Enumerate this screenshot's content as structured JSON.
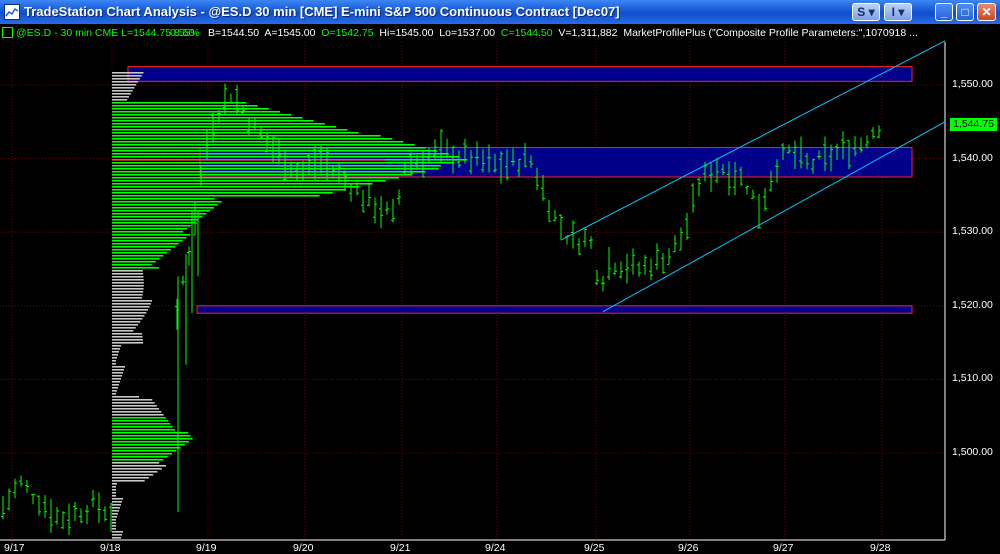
{
  "window": {
    "title": "TradeStation Chart Analysis - @ES.D  30 min  [CME] E-mini S&P 500 Continuous Contract [Dec07]",
    "buttons": {
      "s_menu": "S",
      "i_menu": "I"
    }
  },
  "infobar": {
    "symbol": "@ES.D - 30 min  CME",
    "last": "L=1544.75",
    "change": "8.50",
    "pct": "0.55%",
    "bid": "B=1544.50",
    "ask": "A=1545.00",
    "open": "O=1542.75",
    "high": "Hi=1545.00",
    "low": "Lo=1537.00",
    "close": "C=1544.50",
    "volume": "V=1,311,882",
    "indicator": "MarketProfilePlus (\"Composite Profile Parameters:\",1070918 ..."
  },
  "chart_data": {
    "type": "bar",
    "price_axis": [
      "1,550.00",
      "1,540.00",
      "1,530.00",
      "1,520.00",
      "1,510.00",
      "1,500.00"
    ],
    "price_values": [
      1550,
      1540,
      1530,
      1520,
      1510,
      1500
    ],
    "last_price": "1,544.75",
    "date_axis": [
      "9/17",
      "9/18",
      "9/19",
      "9/20",
      "9/21",
      "9/24",
      "9/25",
      "9/26",
      "9/27",
      "9/28"
    ],
    "ylim": [
      1491,
      1556
    ],
    "zones": [
      {
        "low": 1550.5,
        "high": 1552.5
      },
      {
        "low": 1537.5,
        "high": 1541.5
      },
      {
        "low": 1519,
        "high": 1520
      }
    ],
    "colors": {
      "bars": "#00ff00",
      "zones": "#00008b",
      "zone_border": "#ff2020",
      "channel": "#00c8ff",
      "grid": "#7a0000",
      "profile_green": "#00ff00",
      "profile_gray": "#c8c8c8",
      "volume_mark": "#ff2020"
    }
  }
}
